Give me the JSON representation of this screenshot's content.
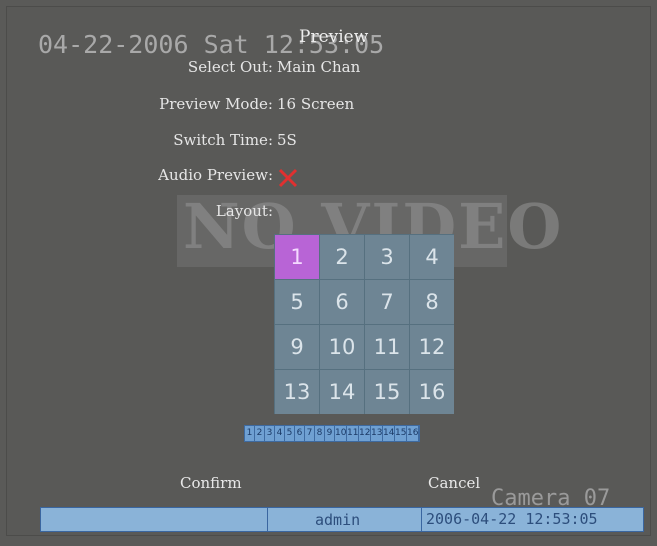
{
  "osd": {
    "datetime": "04-22-2006 Sat 12:53:05",
    "no_video": "NO VIDEO",
    "camera": "Camera 07"
  },
  "menu": {
    "title": "Preview",
    "select_out": {
      "label": "Select Out:",
      "value": "Main Chan"
    },
    "preview_mode": {
      "label": "Preview Mode:",
      "value": "16 Screen"
    },
    "switch_time": {
      "label": "Switch Time:",
      "value": "5S"
    },
    "audio_preview": {
      "label": "Audio Preview:",
      "value_icon": "x-icon",
      "icon_color": "#e03030"
    },
    "layout": {
      "label": "Layout:"
    }
  },
  "layout_grid": {
    "cells": [
      "1",
      "2",
      "3",
      "4",
      "5",
      "6",
      "7",
      "8",
      "9",
      "10",
      "11",
      "12",
      "13",
      "14",
      "15",
      "16"
    ],
    "selected": "1",
    "selected_color": "#b864d6",
    "channel_strip": [
      "1",
      "2",
      "3",
      "4",
      "5",
      "6",
      "7",
      "8",
      "9",
      "10",
      "11",
      "12",
      "13",
      "14",
      "15",
      "16"
    ]
  },
  "buttons": {
    "confirm": "Confirm",
    "cancel": "Cancel"
  },
  "status_bar": {
    "user": "admin",
    "timestamp": "2006-04-22 12:53:05",
    "color": "#8ab3d8"
  }
}
